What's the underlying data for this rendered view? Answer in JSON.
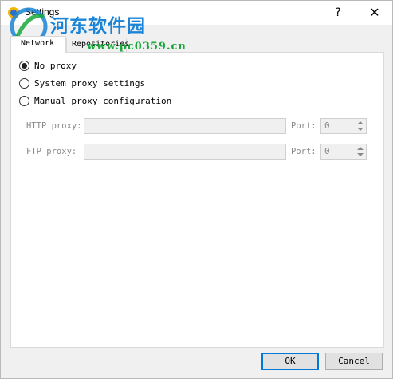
{
  "window": {
    "title": "Settings",
    "help_label": "?",
    "close_label": "✕"
  },
  "watermark": {
    "title": "河东软件园",
    "url": "www.pc0359.cn"
  },
  "tabs": [
    {
      "label": "Network",
      "active": true
    },
    {
      "label": "Repositories",
      "active": false
    }
  ],
  "proxy": {
    "options": [
      {
        "label": "No proxy",
        "checked": true
      },
      {
        "label": "System proxy settings",
        "checked": false
      },
      {
        "label": "Manual proxy configuration",
        "checked": false
      }
    ],
    "http": {
      "label": "HTTP proxy:",
      "value": "",
      "port_label": "Port:",
      "port_value": "0"
    },
    "ftp": {
      "label": "FTP proxy:",
      "value": "",
      "port_label": "Port:",
      "port_value": "0"
    }
  },
  "buttons": {
    "ok": "OK",
    "cancel": "Cancel"
  },
  "colors": {
    "accent": "#0078d7",
    "watermark_blue": "#1b84d6",
    "watermark_green": "#18a83a"
  }
}
